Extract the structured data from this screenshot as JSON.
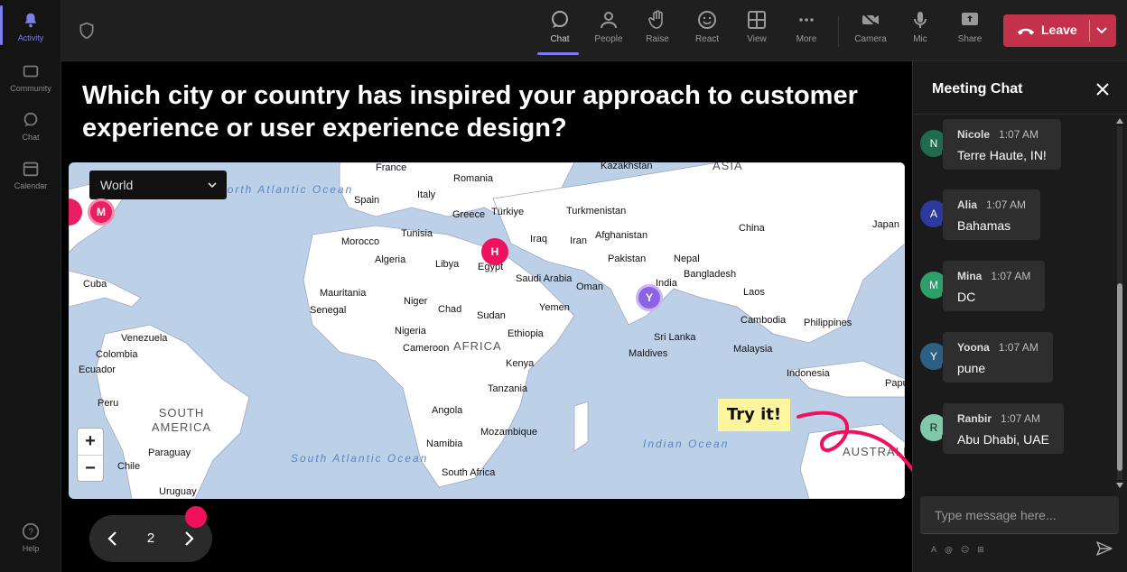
{
  "rail": {
    "items": [
      {
        "label": "Activity",
        "icon": "bell-icon"
      },
      {
        "label": "Community",
        "icon": "community-icon"
      },
      {
        "label": "Chat",
        "icon": "chat-icon"
      },
      {
        "label": "Calendar",
        "icon": "calendar-icon"
      },
      {
        "label": "Help",
        "icon": "help-icon"
      }
    ]
  },
  "toolbar": {
    "chat": "Chat",
    "people": "People",
    "raise": "Raise",
    "react": "React",
    "view": "View",
    "more": "More",
    "camera": "Camera",
    "mic": "Mic",
    "share": "Share",
    "leave": "Leave",
    "leave_color": "#c4314b"
  },
  "stage": {
    "question": "Which city or country has inspired your approach to customer experience or user experience design?",
    "map_filter": "World",
    "zoom_in": "+",
    "zoom_out": "−",
    "try_it": "Try it!",
    "page": "2",
    "pins": [
      {
        "letter": "M",
        "color": "#e91e63"
      },
      {
        "letter": "H",
        "color": "#f0115e"
      },
      {
        "letter": "Y",
        "color": "#8b63e6"
      }
    ],
    "map_labels": {
      "france": "France",
      "romania": "Romania",
      "kazakhstan": "Kazakhstan",
      "asia": "ASIA",
      "north_atlantic": "North Atlantic Ocean",
      "spain": "Spain",
      "italy": "Italy",
      "greece": "Greece",
      "turkiye": "Türkiye",
      "turkmenistan": "Turkmenistan",
      "japan": "Japan",
      "china": "China",
      "tunisia": "Tunisia",
      "iraq": "Iraq",
      "iran": "Iran",
      "afghanistan": "Afghanistan",
      "morocco": "Morocco",
      "algeria": "Algeria",
      "libya": "Libya",
      "egypt": "Egypt",
      "pakistan": "Pakistan",
      "nepal": "Nepal",
      "saudi_arabia": "Saudi Arabia",
      "india": "India",
      "bangladesh": "Bangladesh",
      "cuba": "Cuba",
      "mauritania": "Mauritania",
      "oman": "Oman",
      "laos": "Laos",
      "niger": "Niger",
      "senegal": "Senegal",
      "chad": "Chad",
      "sudan": "Sudan",
      "yemen": "Yemen",
      "cambodia": "Cambodia",
      "philippines": "Philippines",
      "nigeria": "Nigeria",
      "venezuela": "Venezuela",
      "cameroon": "Cameroon",
      "africa": "AFRICA",
      "ethiopia": "Ethiopia",
      "sri_lanka": "Sri Lanka",
      "malaysia": "Malaysia",
      "colombia": "Colombia",
      "maldives": "Maldives",
      "ecuador": "Ecuador",
      "kenya": "Kenya",
      "indonesia": "Indonesia",
      "tanzania": "Tanzania",
      "peru": "Peru",
      "south_america": "SOUTH AMERICA",
      "papua": "Papu",
      "angola": "Angola",
      "mozambique": "Mozambique",
      "paraguay": "Paraguay",
      "namibia": "Namibia",
      "indian_ocean": "Indian Ocean",
      "australia": "AUSTRALIA",
      "chile": "Chile",
      "south_atlantic": "South Atlantic Ocean",
      "south_africa": "South Africa",
      "uruguay": "Uruguay"
    }
  },
  "chat": {
    "title": "Meeting Chat",
    "placeholder": "Type message here...",
    "messages": [
      {
        "initial": "N",
        "name": "Nicole",
        "time": "1:07 AM",
        "text": "Terre Haute, IN!",
        "color": "#1e6b4f"
      },
      {
        "initial": "A",
        "name": "Alia",
        "time": "1:07 AM",
        "text": "Bahamas",
        "color": "#2b3a9c"
      },
      {
        "initial": "M",
        "name": "Mina",
        "time": "1:07 AM",
        "text": "DC",
        "color": "#2e9e6b"
      },
      {
        "initial": "Y",
        "name": "Yoona",
        "time": "1:07 AM",
        "text": "pune",
        "color": "#2c5f83"
      },
      {
        "initial": "R",
        "name": "Ranbir",
        "time": "1:07 AM",
        "text": "Abu Dhabi, UAE",
        "color": "#7fc9a8"
      }
    ]
  }
}
